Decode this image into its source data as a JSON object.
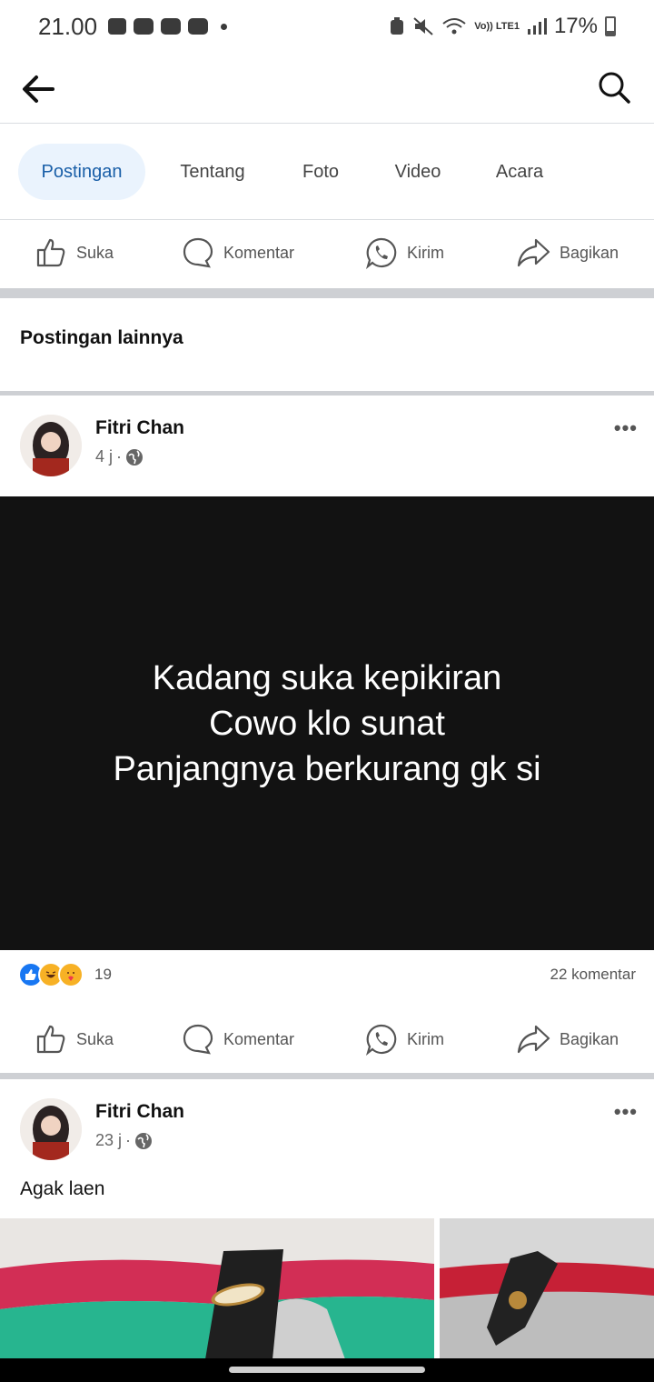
{
  "status_bar": {
    "time": "21.00",
    "network_label": "Vo)) LTE1",
    "battery": "17%"
  },
  "header": {
    "back_icon": "arrow-left-icon",
    "search_icon": "search-icon"
  },
  "tabs": [
    {
      "label": "Postingan",
      "active": true
    },
    {
      "label": "Tentang"
    },
    {
      "label": "Foto"
    },
    {
      "label": "Video"
    },
    {
      "label": "Acara"
    }
  ],
  "actions": {
    "like": "Suka",
    "comment": "Komentar",
    "send": "Kirim",
    "share": "Bagikan"
  },
  "section_title": "Postingan lainnya",
  "posts": [
    {
      "author": "Fitri Chan",
      "time": "4 j",
      "separator": "·",
      "body": "Kadang suka kepikiran\nCowo klo sunat\nPanjangnya berkurang gk si",
      "reaction_count": "19",
      "comments": "22 komentar",
      "more": "•••"
    },
    {
      "author": "Fitri Chan",
      "time": "23 j",
      "separator": "·",
      "caption": "Agak laen",
      "more": "•••"
    }
  ],
  "colors": {
    "accent": "#1a5fa8",
    "tab_active_bg": "#eaf3fd",
    "post_bg": "#121212",
    "divider": "#ced0d4"
  }
}
